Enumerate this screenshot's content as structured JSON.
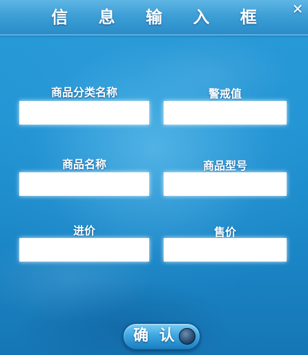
{
  "dialog": {
    "title": "信 息 输 入 框",
    "close_icon": "close-icon"
  },
  "form": {
    "category_name_label": "商品分类名称",
    "alert_value_label": "警戒值",
    "product_name_label": "商品名称",
    "product_model_label": "商品型号",
    "purchase_price_label": "进价",
    "sale_price_label": "售价",
    "category_name_value": "",
    "alert_value_value": "",
    "product_name_value": "",
    "product_model_value": "",
    "purchase_price_value": "",
    "sale_price_value": ""
  },
  "confirm": {
    "label": "确 认"
  }
}
